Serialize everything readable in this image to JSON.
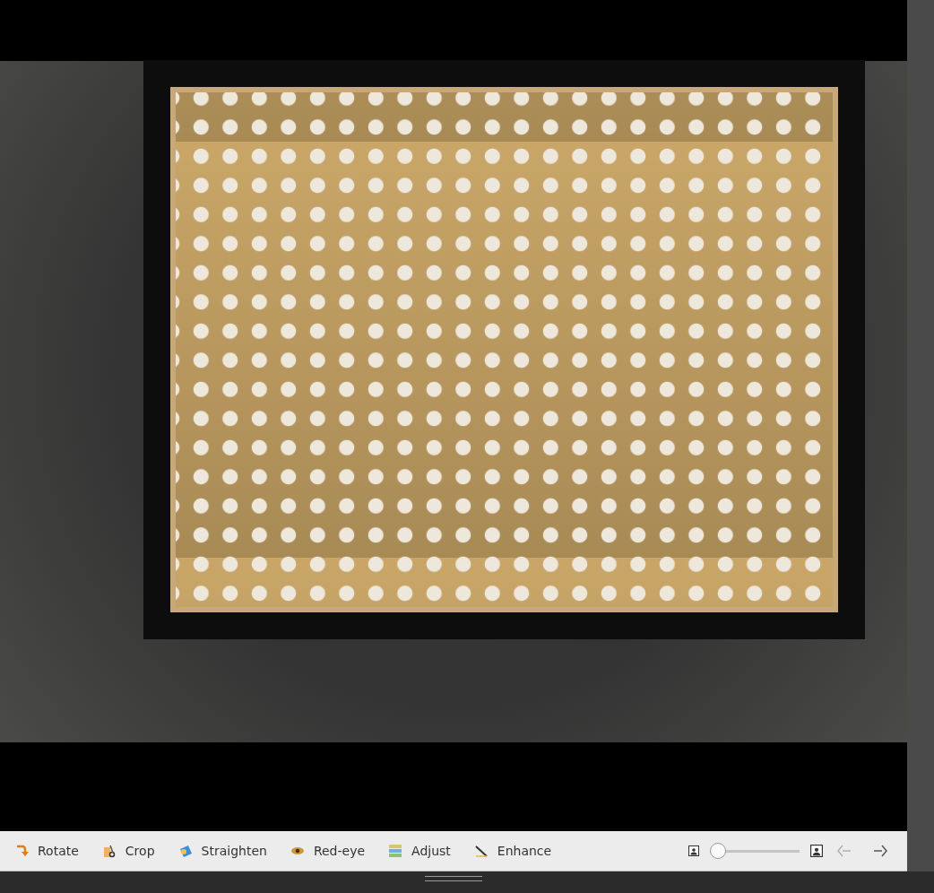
{
  "toolbar": {
    "tools": [
      {
        "kind": "rotate",
        "label": "Rotate"
      },
      {
        "kind": "crop",
        "label": "Crop"
      },
      {
        "kind": "straighten",
        "label": "Straighten"
      },
      {
        "kind": "redeye",
        "label": "Red-eye"
      },
      {
        "kind": "adjust",
        "label": "Adjust"
      },
      {
        "kind": "enhance",
        "label": "Enhance"
      }
    ],
    "zoom_slider": {
      "level": 0
    },
    "navigation": [
      {
        "kind": "previous",
        "disabled": true
      },
      {
        "kind": "next",
        "disabled": false
      }
    ]
  }
}
